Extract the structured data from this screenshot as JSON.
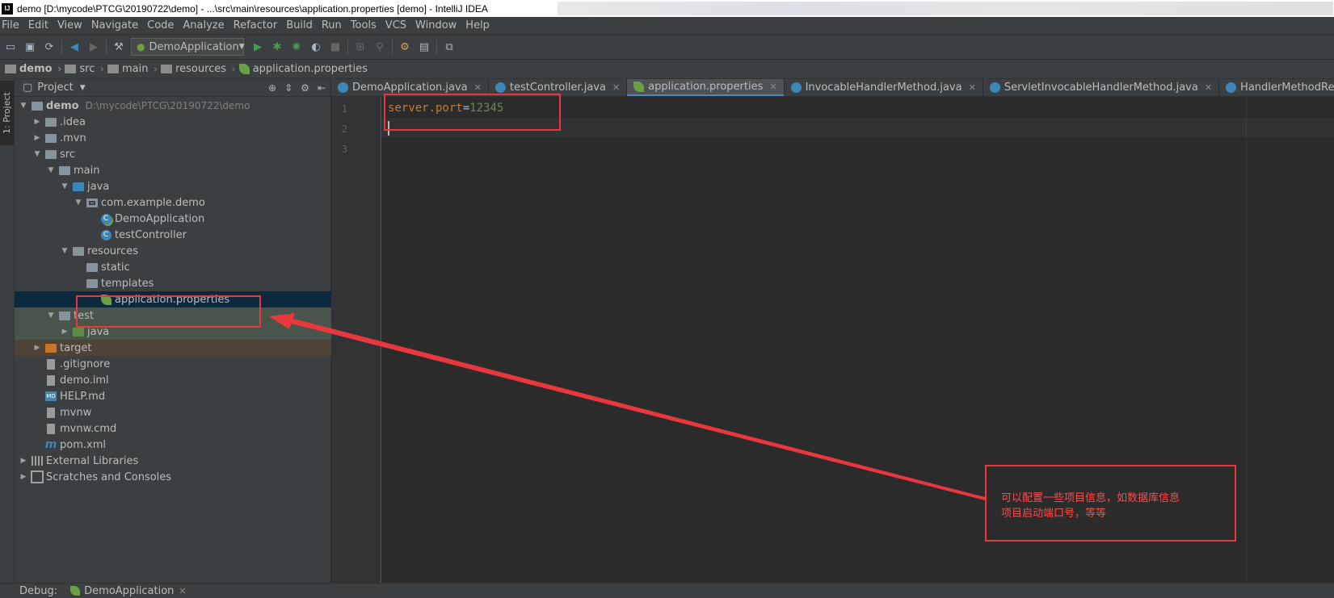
{
  "window": {
    "title": "demo [D:\\mycode\\PTCG\\20190722\\demo] - ...\\src\\main\\resources\\application.properties [demo] - IntelliJ IDEA"
  },
  "menu": [
    "File",
    "Edit",
    "View",
    "Navigate",
    "Code",
    "Analyze",
    "Refactor",
    "Build",
    "Run",
    "Tools",
    "VCS",
    "Window",
    "Help"
  ],
  "toolbar": {
    "run_config": "DemoApplication"
  },
  "breadcrumb": [
    "demo",
    "src",
    "main",
    "resources",
    "application.properties"
  ],
  "side_strip": {
    "project_tab": "1: Project"
  },
  "project_panel": {
    "title": "Project",
    "tree": [
      {
        "label": "demo",
        "path": "D:\\mycode\\PTCG\\20190722\\demo",
        "depth": 0,
        "icon": "folder-icon",
        "expanded": true
      },
      {
        "label": ".idea",
        "depth": 1,
        "icon": "folder-icon",
        "expanded": false
      },
      {
        "label": ".mvn",
        "depth": 1,
        "icon": "folder-icon",
        "expanded": false
      },
      {
        "label": "src",
        "depth": 1,
        "icon": "folder-icon",
        "expanded": true
      },
      {
        "label": "main",
        "depth": 2,
        "icon": "folder-icon",
        "expanded": true
      },
      {
        "label": "java",
        "depth": 3,
        "icon": "source-folder-icon",
        "expanded": true
      },
      {
        "label": "com.example.demo",
        "depth": 4,
        "icon": "package-icon",
        "expanded": true
      },
      {
        "label": "DemoApplication",
        "depth": 5,
        "icon": "spring-class-icon"
      },
      {
        "label": "testController",
        "depth": 5,
        "icon": "class-icon"
      },
      {
        "label": "resources",
        "depth": 3,
        "icon": "resources-folder-icon",
        "expanded": true
      },
      {
        "label": "static",
        "depth": 4,
        "icon": "folder-icon"
      },
      {
        "label": "templates",
        "depth": 4,
        "icon": "folder-icon"
      },
      {
        "label": "application.properties",
        "depth": 5,
        "icon": "spring-properties-icon",
        "selected": true
      },
      {
        "label": "test",
        "depth": 2,
        "icon": "folder-icon",
        "expanded": true
      },
      {
        "label": "java",
        "depth": 3,
        "icon": "test-folder-icon",
        "expanded": false
      },
      {
        "label": "target",
        "depth": 1,
        "icon": "excluded-folder-icon",
        "expanded": false
      },
      {
        "label": ".gitignore",
        "depth": 1,
        "icon": "file-icon"
      },
      {
        "label": "demo.iml",
        "depth": 1,
        "icon": "file-icon"
      },
      {
        "label": "HELP.md",
        "depth": 1,
        "icon": "markdown-icon"
      },
      {
        "label": "mvnw",
        "depth": 1,
        "icon": "file-icon"
      },
      {
        "label": "mvnw.cmd",
        "depth": 1,
        "icon": "file-icon"
      },
      {
        "label": "pom.xml",
        "depth": 1,
        "icon": "maven-icon"
      },
      {
        "label": "External Libraries",
        "depth": 0,
        "icon": "library-icon",
        "expanded": false
      },
      {
        "label": "Scratches and Consoles",
        "depth": 0,
        "icon": "scratch-icon",
        "expanded": false
      }
    ]
  },
  "editor": {
    "tabs": [
      {
        "label": "DemoApplication.java",
        "active": false
      },
      {
        "label": "testController.java",
        "active": false
      },
      {
        "label": "application.properties",
        "active": true
      },
      {
        "label": "InvocableHandlerMethod.java",
        "active": false
      },
      {
        "label": "ServletInvocableHandlerMethod.java",
        "active": false
      },
      {
        "label": "HandlerMethodReturnValueHandl",
        "active": false
      }
    ],
    "line_numbers": [
      "1",
      "2",
      "3"
    ],
    "line1": {
      "key": "server.port",
      "eq": "=",
      "value": "12345"
    }
  },
  "bottom": {
    "debug_label": "Debug:",
    "debug_tab": "DemoApplication"
  },
  "annotation": {
    "line1": "可以配置一些项目信息，如数据库信息",
    "line2": "项目启动端口号，等等",
    "color": "#e8383d"
  }
}
